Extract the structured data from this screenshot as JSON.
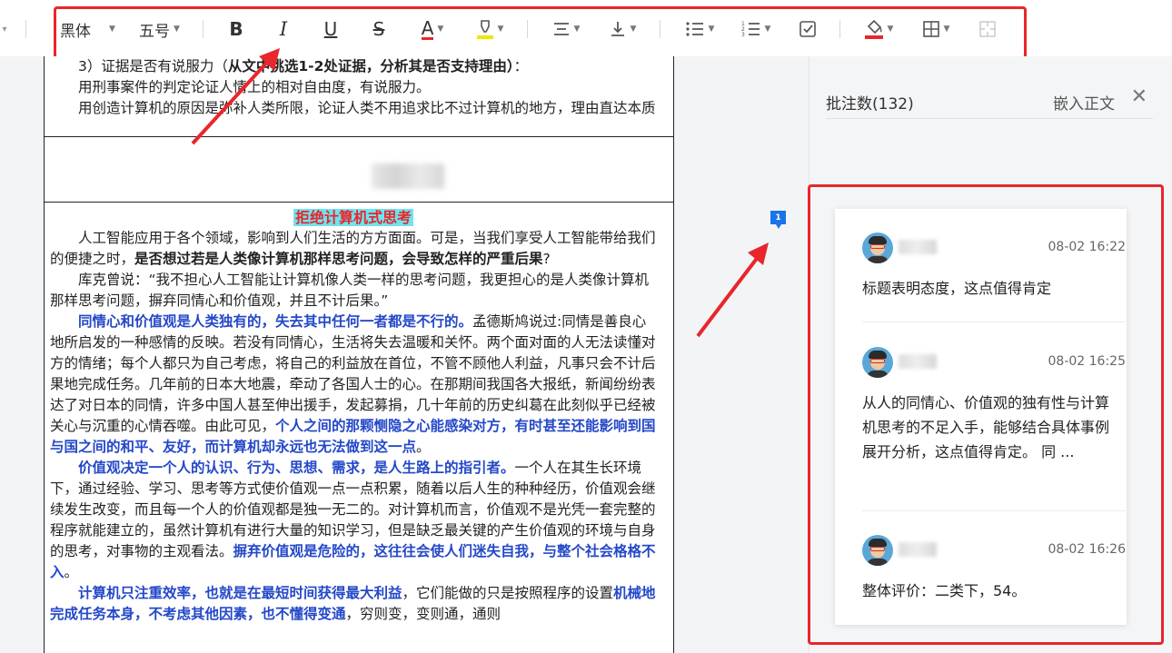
{
  "toolbar": {
    "font_family": "黑体",
    "font_size": "五号",
    "bold_glyph": "B",
    "italic_glyph": "I",
    "underline_glyph": "U",
    "strike_glyph": "S",
    "font_color_glyph": "A",
    "accent_red": "#e8262b",
    "accent_yellow": "#f2e600"
  },
  "document": {
    "upper_block": {
      "line1_plain": "3）证据是否有说服力（",
      "line1_bold": "从文中挑选1-2处证据，分析其是否支持理由）",
      "line1_end": "：",
      "line2": "用刑事案件的判定论证人情上的相对自由度，有说服力。",
      "line3": "用创造计算机的原因是弥补人类所限，论证人类不用追求比不过计算机的地方，理由直达本质"
    },
    "essay": {
      "title": "拒绝计算机式思考",
      "p1_plain": "人工智能应用于各个领域，影响到人们生活的方方面面。可是，当我们享受人工智能带给我们的便捷之时，",
      "p1_bold": "是否想过若是人类像计算机那样思考问题，会导致怎样的严重后果",
      "p1_end": "?",
      "p2": "库克曾说：“我不担心人工智能让计算机像人类一样的思考问题，我更担心的是人类像计算机那样思考问题，摒弃同情心和价值观，并且不计后果。”",
      "p3_blue": "同情心和价值观是人类独有的，失去其中任何一者都是不行的。",
      "p3_plain": "孟德斯鸠说过:同情是善良心地所启发的一种感情的反映。若没有同情心，生活将失去温暖和关怀。两个面对面的人无法读懂对方的情绪；每个人都只为自己考虑，将自己的利益放在首位，不管不顾他人利益，凡事只会不计后果地完成任务。几年前的日本大地震，牵动了各国人士的心。在那期间我国各大报纸，新闻纷纷表达了对日本的同情，许多中国人甚至伸出援手，发起募捐，几十年前的历史纠葛在此刻似乎已经被关心与沉重的心情吞噬。由此可见，",
      "p3_blue2": "个人之间的那颗恻隐之心能感染对方，有时甚至还能影响到国与国之间的和平、友好，而计算机却永远也无法做到这一点",
      "p3_end": "。",
      "p4_blue": "价值观决定一个人的认识、行为、思想、需求，是人生路上的指引者。",
      "p4_plain": "一个人在其生长环境下，通过经验、学习、思考等方式使价值观一点一点积累，随着以后人生的种种经历，价值观会继续发生改变，而且每一个人的价值观都是独一无二的。对计算机而言，价值观不是光凭一套完整的程序就能建立的，虽然计算机有进行大量的知识学习，但是缺乏最关键的产生价值观的环境与自身的思考，对事物的主观看法。",
      "p4_blue2": "摒弃价值观是危险的，这往往会使人们迷失自我，与整个社会格格不入",
      "p4_end": "。",
      "p5_blue": "计算机只注重效率，也就是在最短时间获得最大利益",
      "p5_plain": "，它们能做的只是按照程序的设置",
      "p5_blue2": "机械地完成任务本身，不考虑其他因素，也不懂得变通",
      "p5_end": "，穷则变，变则通，通则"
    },
    "comment_marker": "1"
  },
  "comments_panel": {
    "title": "批注数(132)",
    "embed_label": "嵌入正文",
    "close_glyph": "✕",
    "comments": [
      {
        "time": "08-02 16:22",
        "text": "标题表明态度，这点值得肯定"
      },
      {
        "time": "08-02 16:25",
        "text": "从人的同情心、价值观的独有性与计算机思考的不足入手，能够结合具体事例展开分析，这点值得肯定。 同 ..."
      },
      {
        "time": "08-02 16:26",
        "text": "整体评价：二类下，54。"
      }
    ]
  }
}
